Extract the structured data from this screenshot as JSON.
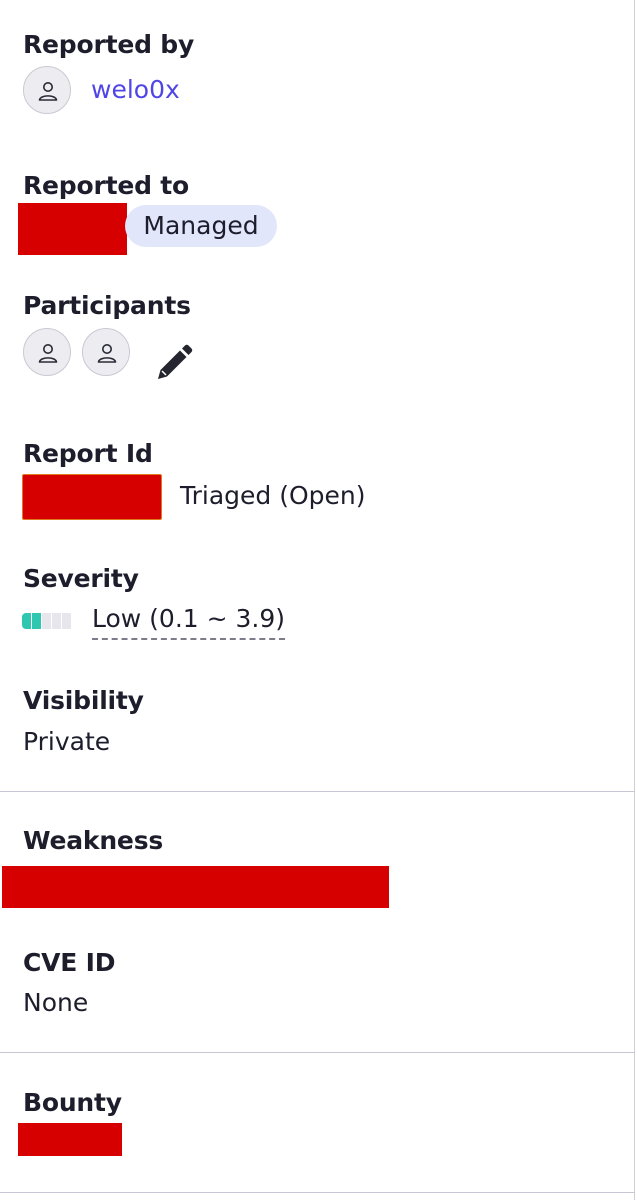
{
  "reported_by": {
    "label": "Reported by",
    "username": "welo0x"
  },
  "reported_to": {
    "label": "Reported to",
    "badge": "Managed"
  },
  "participants": {
    "label": "Participants",
    "count": 2
  },
  "report_id": {
    "label": "Report Id",
    "status": "Triaged (Open)"
  },
  "severity": {
    "label": "Severity",
    "value": "Low (0.1 ~ 3.9)",
    "level_filled": 2,
    "level_total": 5,
    "color": "#2fc7b0"
  },
  "visibility": {
    "label": "Visibility",
    "value": "Private"
  },
  "weakness": {
    "label": "Weakness"
  },
  "cve": {
    "label": "CVE ID",
    "value": "None"
  },
  "bounty": {
    "label": "Bounty"
  },
  "colors": {
    "redaction": "#d60000",
    "link": "#4f46e5",
    "pill_bg": "#e1e6fb"
  }
}
